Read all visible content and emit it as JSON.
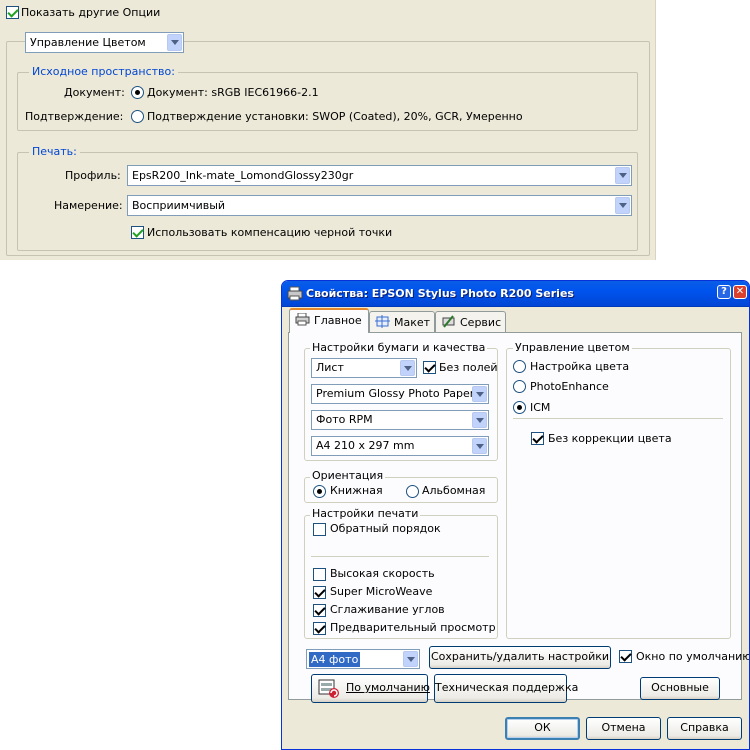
{
  "top_panel": {
    "show_options_label": "Показать другие Опции",
    "section_select_value": "Управление Цветом",
    "source_space": {
      "legend": "Исходное пространство:",
      "document_label": "Документ:",
      "document_option": "Документ:  sRGB IEC61966-2.1",
      "proof_label": "Подтверждение:",
      "proof_option": "Подтверждение установки:  SWOP (Coated), 20%, GCR, Умеренно"
    },
    "print": {
      "legend": "Печать:",
      "profile_label": "Профиль:",
      "profile_value": "EpsR200_Ink-mate_LomondGlossy230gr",
      "intent_label": "Намерение:",
      "intent_value": "Восприимчивый",
      "bpc_label": "Использовать компенсацию черной точки"
    }
  },
  "dialog": {
    "title": "Свойства: EPSON Stylus Photo R200 Series",
    "help_glyph": "?",
    "close_glyph": "✕",
    "tabs": [
      {
        "label": "Главное",
        "active": true
      },
      {
        "label": "Макет",
        "active": false
      },
      {
        "label": "Сервис",
        "active": false
      }
    ],
    "paper_quality": {
      "legend": "Настройки бумаги и качества",
      "source_value": "Лист",
      "borderless_label": "Без полей",
      "media_value": "Premium Glossy Photo Paper",
      "quality_value": "Фото RPM",
      "size_value": "A4 210 x 297 mm"
    },
    "orientation": {
      "legend": "Ориентация",
      "portrait_label": "Книжная",
      "landscape_label": "Альбомная"
    },
    "print_settings": {
      "legend": "Настройки печати",
      "reverse_label": "Обратный порядок",
      "high_speed_label": "Высокая скорость",
      "microweave_label": "Super MicroWeave",
      "smoothing_label": "Сглаживание углов",
      "preview_label": "Предварительный просмотр"
    },
    "color_management": {
      "legend": "Управление цветом",
      "color_controls_label": "Настройка цвета",
      "photoenhance_label": "PhotoEnhance",
      "icm_label": "ICM",
      "no_correction_label": "Без коррекции цвета"
    },
    "preset_value": "A4 фото",
    "save_settings_label": "Сохранить/удалить настройки",
    "default_window_label": "Окно по умолчанию",
    "defaults_label": "По умолчанию",
    "support_label": "Техническая поддержка",
    "basic_label": "Основные",
    "ok_label": "ОК",
    "cancel_label": "Отмена",
    "help_label": "Справка"
  },
  "colors": {
    "window_bg": "#ece9d8",
    "title_blue": "#0053ee",
    "legend_blue": "#0046d5",
    "check_green": "#21a121",
    "selection": "#316ac5"
  }
}
